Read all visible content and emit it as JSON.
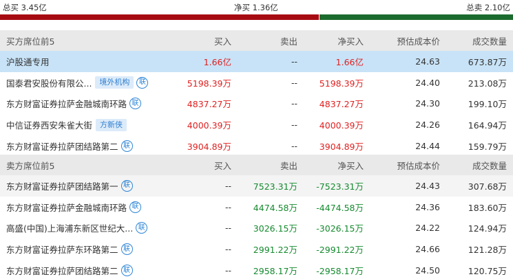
{
  "summary": {
    "total_buy": "总买 3.45亿",
    "net_buy": "净买 1.36亿",
    "total_sell": "总卖 2.10亿",
    "buy_ratio": 0.622
  },
  "colors": {
    "buy": "#a60b12",
    "sell": "#1c6b2e",
    "highlight": "#c8e3f7"
  },
  "buy_table": {
    "headers": [
      "买方席位前5",
      "买入",
      "卖出",
      "净买入",
      "预估成本价",
      "成交数量"
    ],
    "rows": [
      {
        "name": "沪股通专用",
        "tag": "",
        "lian": "",
        "buy": "1.66亿",
        "sell": "--",
        "net": "1.66亿",
        "cost": "24.63",
        "vol": "673.87万"
      },
      {
        "name": "国泰君安股份有限公...",
        "tag": "境外机构",
        "lian": "联",
        "buy": "5198.39万",
        "sell": "--",
        "net": "5198.39万",
        "cost": "24.40",
        "vol": "213.08万"
      },
      {
        "name": "东方财富证券拉萨金融城南环路",
        "tag": "",
        "lian": "联",
        "buy": "4837.27万",
        "sell": "--",
        "net": "4837.27万",
        "cost": "24.30",
        "vol": "199.10万"
      },
      {
        "name": "中信证券西安朱雀大街",
        "tag": "方新侠",
        "lian": "",
        "buy": "4000.39万",
        "sell": "--",
        "net": "4000.39万",
        "cost": "24.26",
        "vol": "164.94万"
      },
      {
        "name": "东方财富证券拉萨团结路第二",
        "tag": "",
        "lian": "联",
        "buy": "3904.89万",
        "sell": "--",
        "net": "3904.89万",
        "cost": "24.44",
        "vol": "159.79万"
      }
    ]
  },
  "sell_table": {
    "headers": [
      "卖方席位前5",
      "买入",
      "卖出",
      "净买入",
      "预估成本价",
      "成交数量"
    ],
    "rows": [
      {
        "name": "东方财富证券拉萨团结路第一",
        "tag": "",
        "lian": "联",
        "buy": "--",
        "sell": "7523.31万",
        "net": "-7523.31万",
        "cost": "24.43",
        "vol": "307.68万"
      },
      {
        "name": "东方财富证券拉萨金融城南环路",
        "tag": "",
        "lian": "联",
        "buy": "--",
        "sell": "4474.58万",
        "net": "-4474.58万",
        "cost": "24.36",
        "vol": "183.60万"
      },
      {
        "name": "高盛(中国)上海浦东新区世纪大...",
        "tag": "",
        "lian": "联",
        "buy": "--",
        "sell": "3026.15万",
        "net": "-3026.15万",
        "cost": "24.22",
        "vol": "124.94万"
      },
      {
        "name": "东方财富证券拉萨东环路第二",
        "tag": "",
        "lian": "联",
        "buy": "--",
        "sell": "2991.22万",
        "net": "-2991.22万",
        "cost": "24.66",
        "vol": "121.28万"
      },
      {
        "name": "东方财富证券拉萨团结路第二",
        "tag": "",
        "lian": "联",
        "buy": "--",
        "sell": "2958.17万",
        "net": "-2958.17万",
        "cost": "24.50",
        "vol": "120.75万"
      }
    ]
  }
}
